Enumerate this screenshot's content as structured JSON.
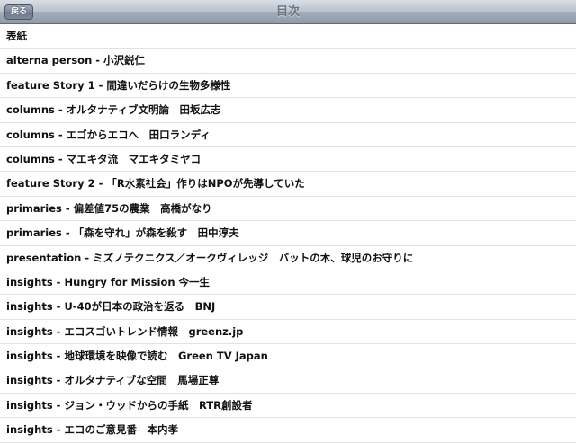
{
  "navbar": {
    "back_label": "戻る",
    "title": "目次"
  },
  "toc": {
    "items": [
      "表紙",
      "alterna person - 小沢鋭仁",
      "feature Story 1 - 間違いだらけの生物多様性",
      "columns - オルタナティブ文明論　田坂広志",
      "columns - エゴからエコへ　田口ランディ",
      "columns - マエキタ流　マエキタミヤコ",
      "feature Story 2 - 「R水素社会」作りはNPOが先導していた",
      "primaries - 偏差値75の農業　高橋がなり",
      "primaries - 「森を守れ」が森を殺す　田中淳夫",
      "presentation - ミズノテクニクス／オークヴィレッジ　バットの木、球児のお守りに",
      "insights - Hungry for Mission 今一生",
      "insights - U-40が日本の政治を返る　BNJ",
      "insights - エコスゴいトレンド情報　greenz.jp",
      "insights - 地球環境を映像で読む　Green TV Japan",
      "insights - オルタナティブな空間　馬場正尊",
      "insights - ジョン・ウッドからの手紙　RTR創設者",
      "insights - エコのご意見番　本内孝"
    ]
  }
}
